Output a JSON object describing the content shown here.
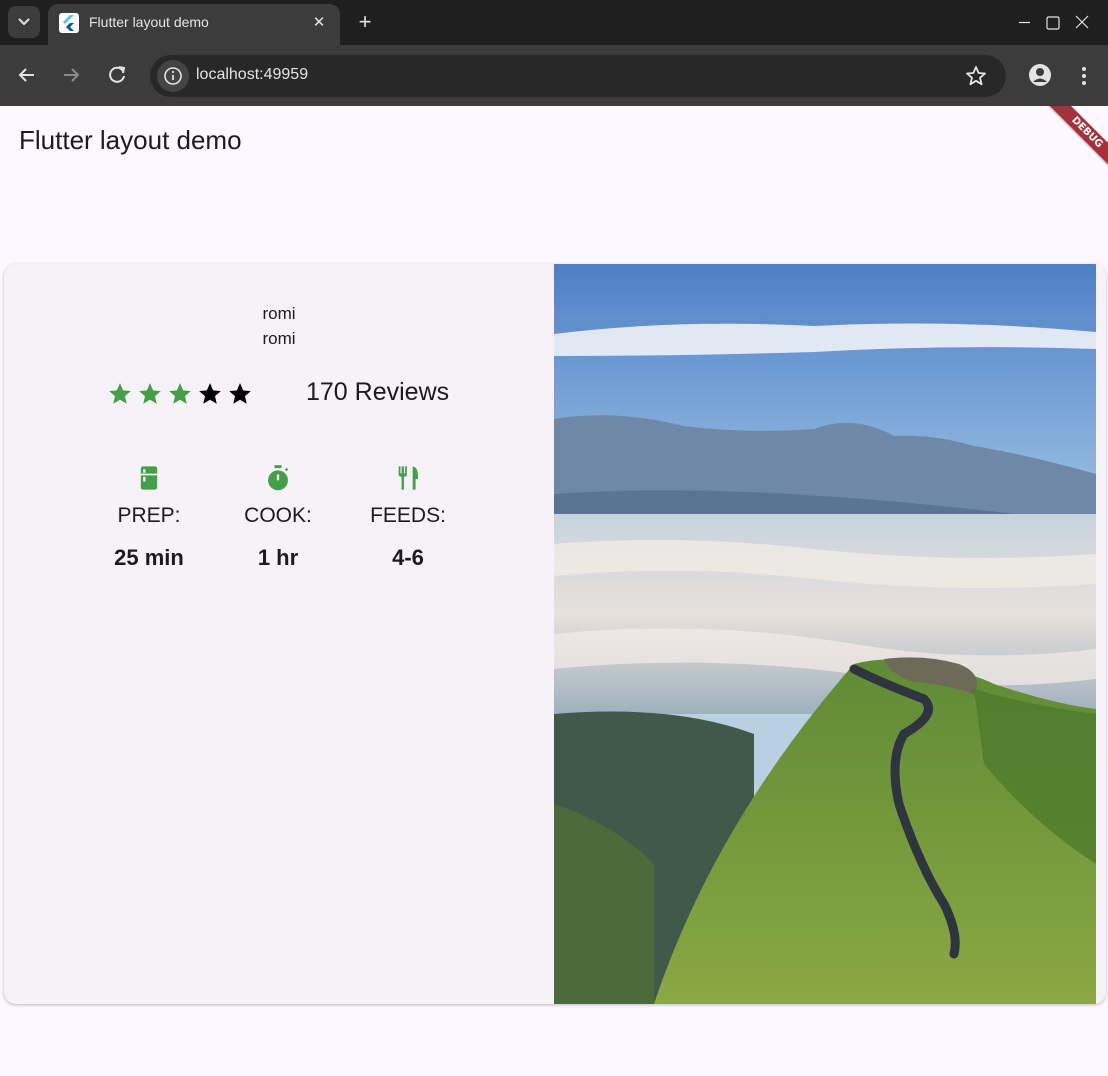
{
  "browser": {
    "tab_title": "Flutter layout demo",
    "url": "localhost:49959",
    "icons": [
      "tab-search-icon",
      "flutter-favicon-icon",
      "close-icon",
      "plus-icon",
      "minimize-icon",
      "maximize-icon",
      "window-close-icon",
      "back-arrow-icon",
      "forward-arrow-icon",
      "reload-icon",
      "site-info-icon",
      "bookmark-star-icon",
      "profile-icon",
      "more-vert-icon"
    ]
  },
  "app": {
    "title": "Flutter layout demo",
    "debug_label": "DEBUG",
    "card": {
      "name_line_1": "romi",
      "name_line_2": "romi",
      "rating": {
        "filled": 3,
        "total": 5,
        "filled_color": "#43a047",
        "empty_color": "#000000"
      },
      "reviews": "170 Reviews",
      "stats": [
        {
          "icon": "kitchen-icon",
          "label": "PREP:",
          "value": "25 min"
        },
        {
          "icon": "timer-icon",
          "label": "COOK:",
          "value": "1 hr"
        },
        {
          "icon": "restaurant-icon",
          "label": "FEEDS:",
          "value": "4-6"
        }
      ],
      "accent_color": "#43a047",
      "photo": "mountain-ridge-landscape"
    }
  }
}
